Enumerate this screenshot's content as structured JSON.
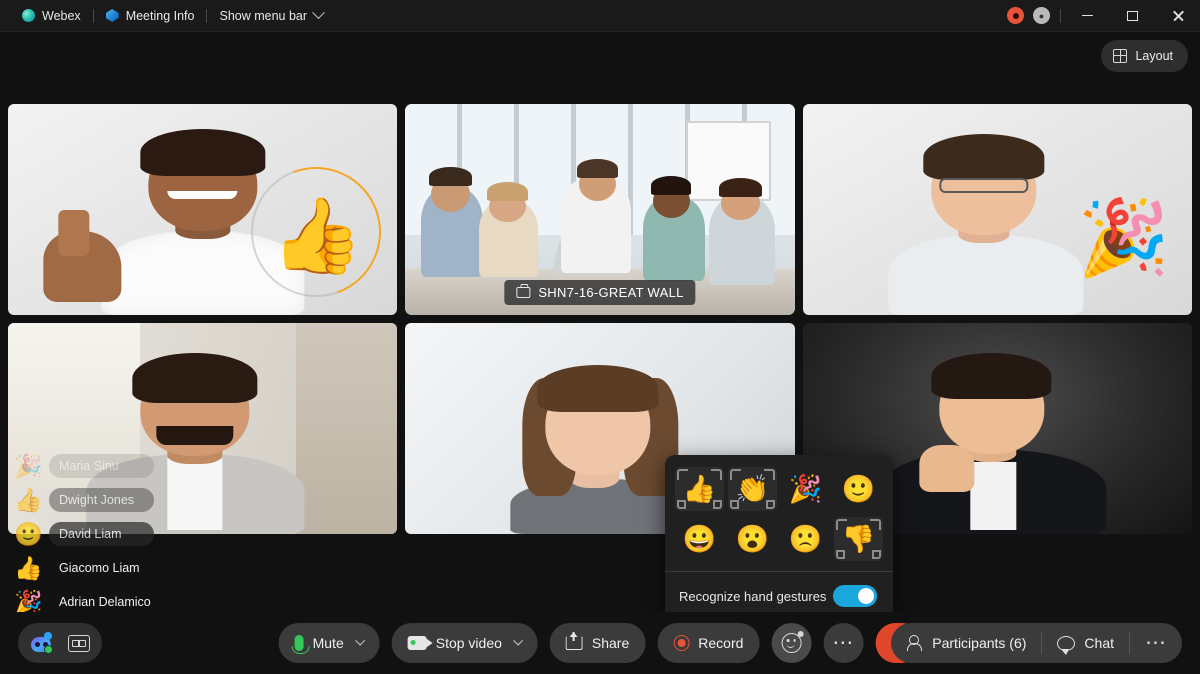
{
  "titlebar": {
    "app_name": "Webex",
    "meeting_info": "Meeting Info",
    "show_menu_bar": "Show menu bar",
    "recording_indicator": "recording-indicator",
    "network_indicator": "network-quality",
    "minimize": "Minimize",
    "maximize": "Maximize",
    "close": "Close"
  },
  "layout": {
    "label": "Layout"
  },
  "tiles": [
    {
      "id": "tile-1",
      "name": "participant-thumbs-up",
      "label": "",
      "active": false,
      "reaction": "👍",
      "has_ring": true
    },
    {
      "id": "tile-2",
      "name": "room-device-great-wall",
      "label": "SHN7-16-GREAT WALL",
      "active": true,
      "reaction": "",
      "has_ring": false
    },
    {
      "id": "tile-3",
      "name": "participant-celebrate",
      "label": "",
      "active": false,
      "reaction": "🎉",
      "has_ring": false
    },
    {
      "id": "tile-4",
      "name": "participant-bottom-left",
      "label": "",
      "active": false,
      "reaction": "",
      "has_ring": false
    },
    {
      "id": "tile-5",
      "name": "participant-bottom-center",
      "label": "",
      "active": false,
      "reaction": "",
      "has_ring": false
    },
    {
      "id": "tile-6",
      "name": "participant-bottom-right",
      "label": "",
      "active": false,
      "reaction": "",
      "has_ring": false
    }
  ],
  "reaction_toasts": [
    {
      "emoji": "🎉",
      "name": "Maria Sinu",
      "fade": "f1"
    },
    {
      "emoji": "👍",
      "name": "Dwight Jones",
      "fade": "f2"
    },
    {
      "emoji": "🙂",
      "name": "David Liam",
      "fade": "f3"
    },
    {
      "emoji": "👍",
      "name": "Giacomo Liam",
      "fade": "f4"
    },
    {
      "emoji": "🎉",
      "name": "Adrian Delamico",
      "fade": "f4"
    }
  ],
  "reactions_popup": {
    "items": [
      {
        "emoji": "👍",
        "name": "reaction-thumbs-up",
        "gesture": true
      },
      {
        "emoji": "👏",
        "name": "reaction-clap",
        "gesture": true
      },
      {
        "emoji": "🎉",
        "name": "reaction-celebrate",
        "gesture": false
      },
      {
        "emoji": "🙂",
        "name": "reaction-smile",
        "gesture": false
      },
      {
        "emoji": "😀",
        "name": "reaction-laugh",
        "gesture": false
      },
      {
        "emoji": "😮",
        "name": "reaction-surprised",
        "gesture": false
      },
      {
        "emoji": "🙁",
        "name": "reaction-sad",
        "gesture": false
      },
      {
        "emoji": "👎",
        "name": "reaction-thumbs-down",
        "gesture": true
      }
    ],
    "toggle_label": "Recognize hand gestures",
    "toggle_on": true,
    "toggle_color": "#1aa7dc"
  },
  "bottombar": {
    "assistant": "ai-assistant",
    "captions": "closed-captions",
    "mute": "Mute",
    "stop_video": "Stop video",
    "share": "Share",
    "record": "Record",
    "reactions": "reactions",
    "more": "More options",
    "end_call": "End meeting",
    "participants": "Participants (6)",
    "chat": "Chat",
    "more_right": "More"
  },
  "colors": {
    "accent_active_tile": "#00a6e0",
    "toggle_on": "#1aa7dc",
    "end_call": "#e0472a",
    "record": "#e8543a",
    "mic_on": "#36c75a",
    "window_bg": "#111111"
  }
}
